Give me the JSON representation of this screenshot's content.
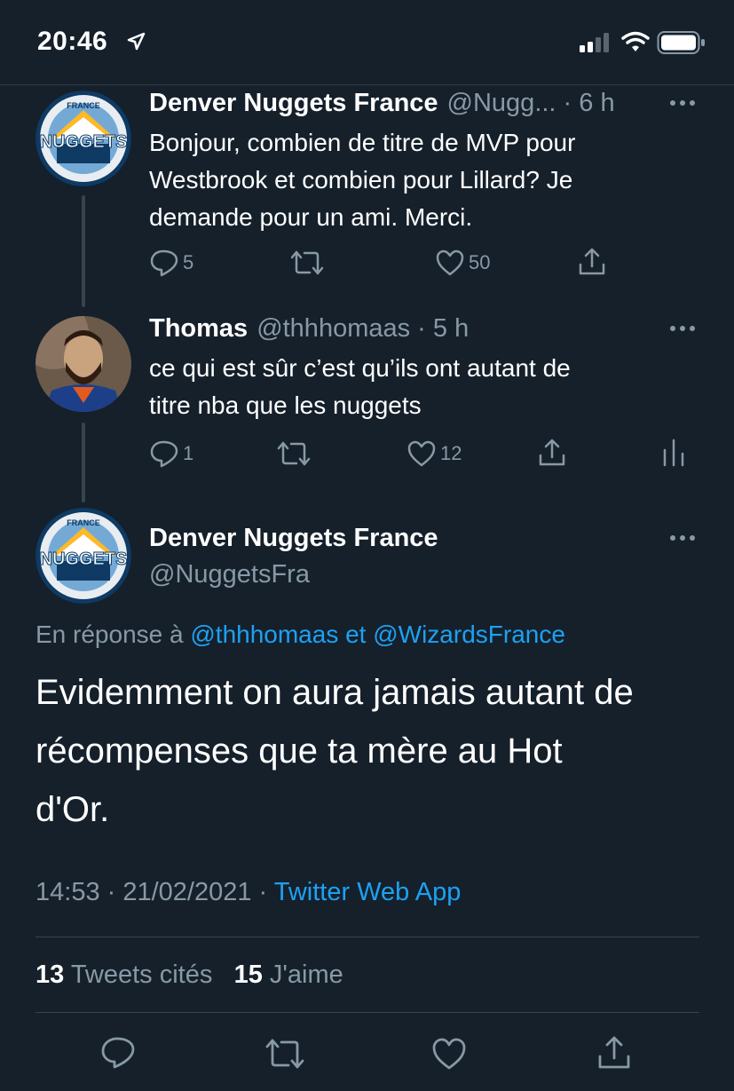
{
  "status_bar": {
    "time": "20:46"
  },
  "tweet1": {
    "name": "Denver Nuggets France",
    "handle_time": "@Nugg... · 6 h",
    "text_lines": [
      "Bonjour, combien de titre de MVP pour",
      "Westbrook et combien pour Lillard? Je",
      "demande pour un ami. Merci."
    ],
    "replies": "5",
    "likes": "50"
  },
  "tweet2": {
    "name": "Thomas",
    "handle_time": "@thhhomaas · 5 h",
    "text_lines": [
      "ce qui est sûr c’est qu’ils ont autant de",
      "titre nba que les nuggets"
    ],
    "replies": "1",
    "likes": "12"
  },
  "main_tweet": {
    "name": "Denver Nuggets France",
    "handle": "@NuggetsFra",
    "reply_prefix": "En réponse à",
    "reply_to": "@thhhomaas et @WizardsFrance",
    "text_lines": [
      "Evidemment on aura jamais autant de",
      "récompenses que ta mère au Hot",
      "d'Or."
    ],
    "timestamp": "14:53 · 21/02/2021 ·",
    "source": "Twitter Web App",
    "quote_count": "13",
    "quote_label": "Tweets cités",
    "like_count": "15",
    "like_label": "J'aime"
  },
  "logo": {
    "top_text": "FRANCE",
    "word": "NUGGETS"
  },
  "colors": {
    "background": "#15202b",
    "muted": "#8899a6",
    "link": "#1da1f2",
    "divider": "#38444d"
  }
}
